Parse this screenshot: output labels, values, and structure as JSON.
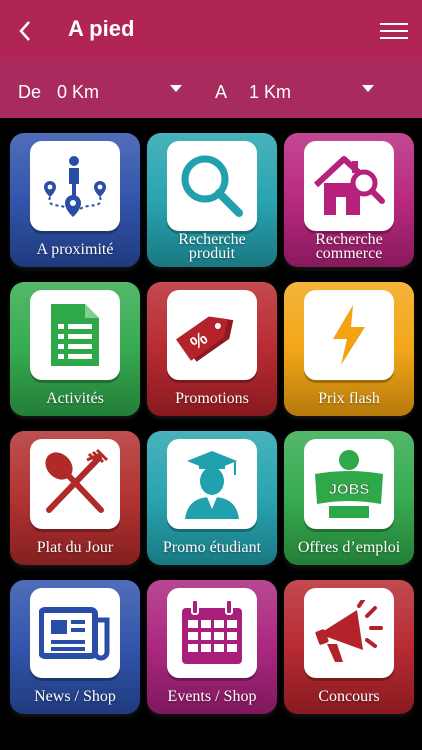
{
  "header": {
    "title": "A pied"
  },
  "filters": {
    "from_label": "De",
    "from_value": "0 Km",
    "to_label": "A",
    "to_value": "1 Km"
  },
  "tiles": [
    {
      "label": "A proximité",
      "color": "#2a4ea8",
      "icon": "location-pins-icon"
    },
    {
      "label": "Recherche produit",
      "color": "#21a1ad",
      "icon": "search-icon"
    },
    {
      "label": "Recherche commerce",
      "color": "#b5217b",
      "icon": "house-search-icon"
    },
    {
      "label": "Activités",
      "color": "#2fa84a",
      "icon": "document-icon"
    },
    {
      "label": "Promotions",
      "color": "#b5232a",
      "icon": "price-tag-icon"
    },
    {
      "label": "Prix flash",
      "color": "#f2a30f",
      "icon": "lightning-icon"
    },
    {
      "label": "Plat du Jour",
      "color": "#b02a2a",
      "icon": "spoon-fork-icon"
    },
    {
      "label": "Promo étudiant",
      "color": "#21a1ad",
      "icon": "graduate-icon"
    },
    {
      "label": "Offres d’emploi",
      "color": "#2fa84a",
      "icon": "jobs-icon"
    },
    {
      "label": "News / Shop",
      "color": "#2a4ea8",
      "icon": "newspaper-icon"
    },
    {
      "label": "Events / Shop",
      "color": "#a8207b",
      "icon": "calendar-icon"
    },
    {
      "label": "Concours",
      "color": "#b5232a",
      "icon": "megaphone-icon"
    }
  ],
  "jobs_text": "JOBS",
  "percent_text": "%"
}
